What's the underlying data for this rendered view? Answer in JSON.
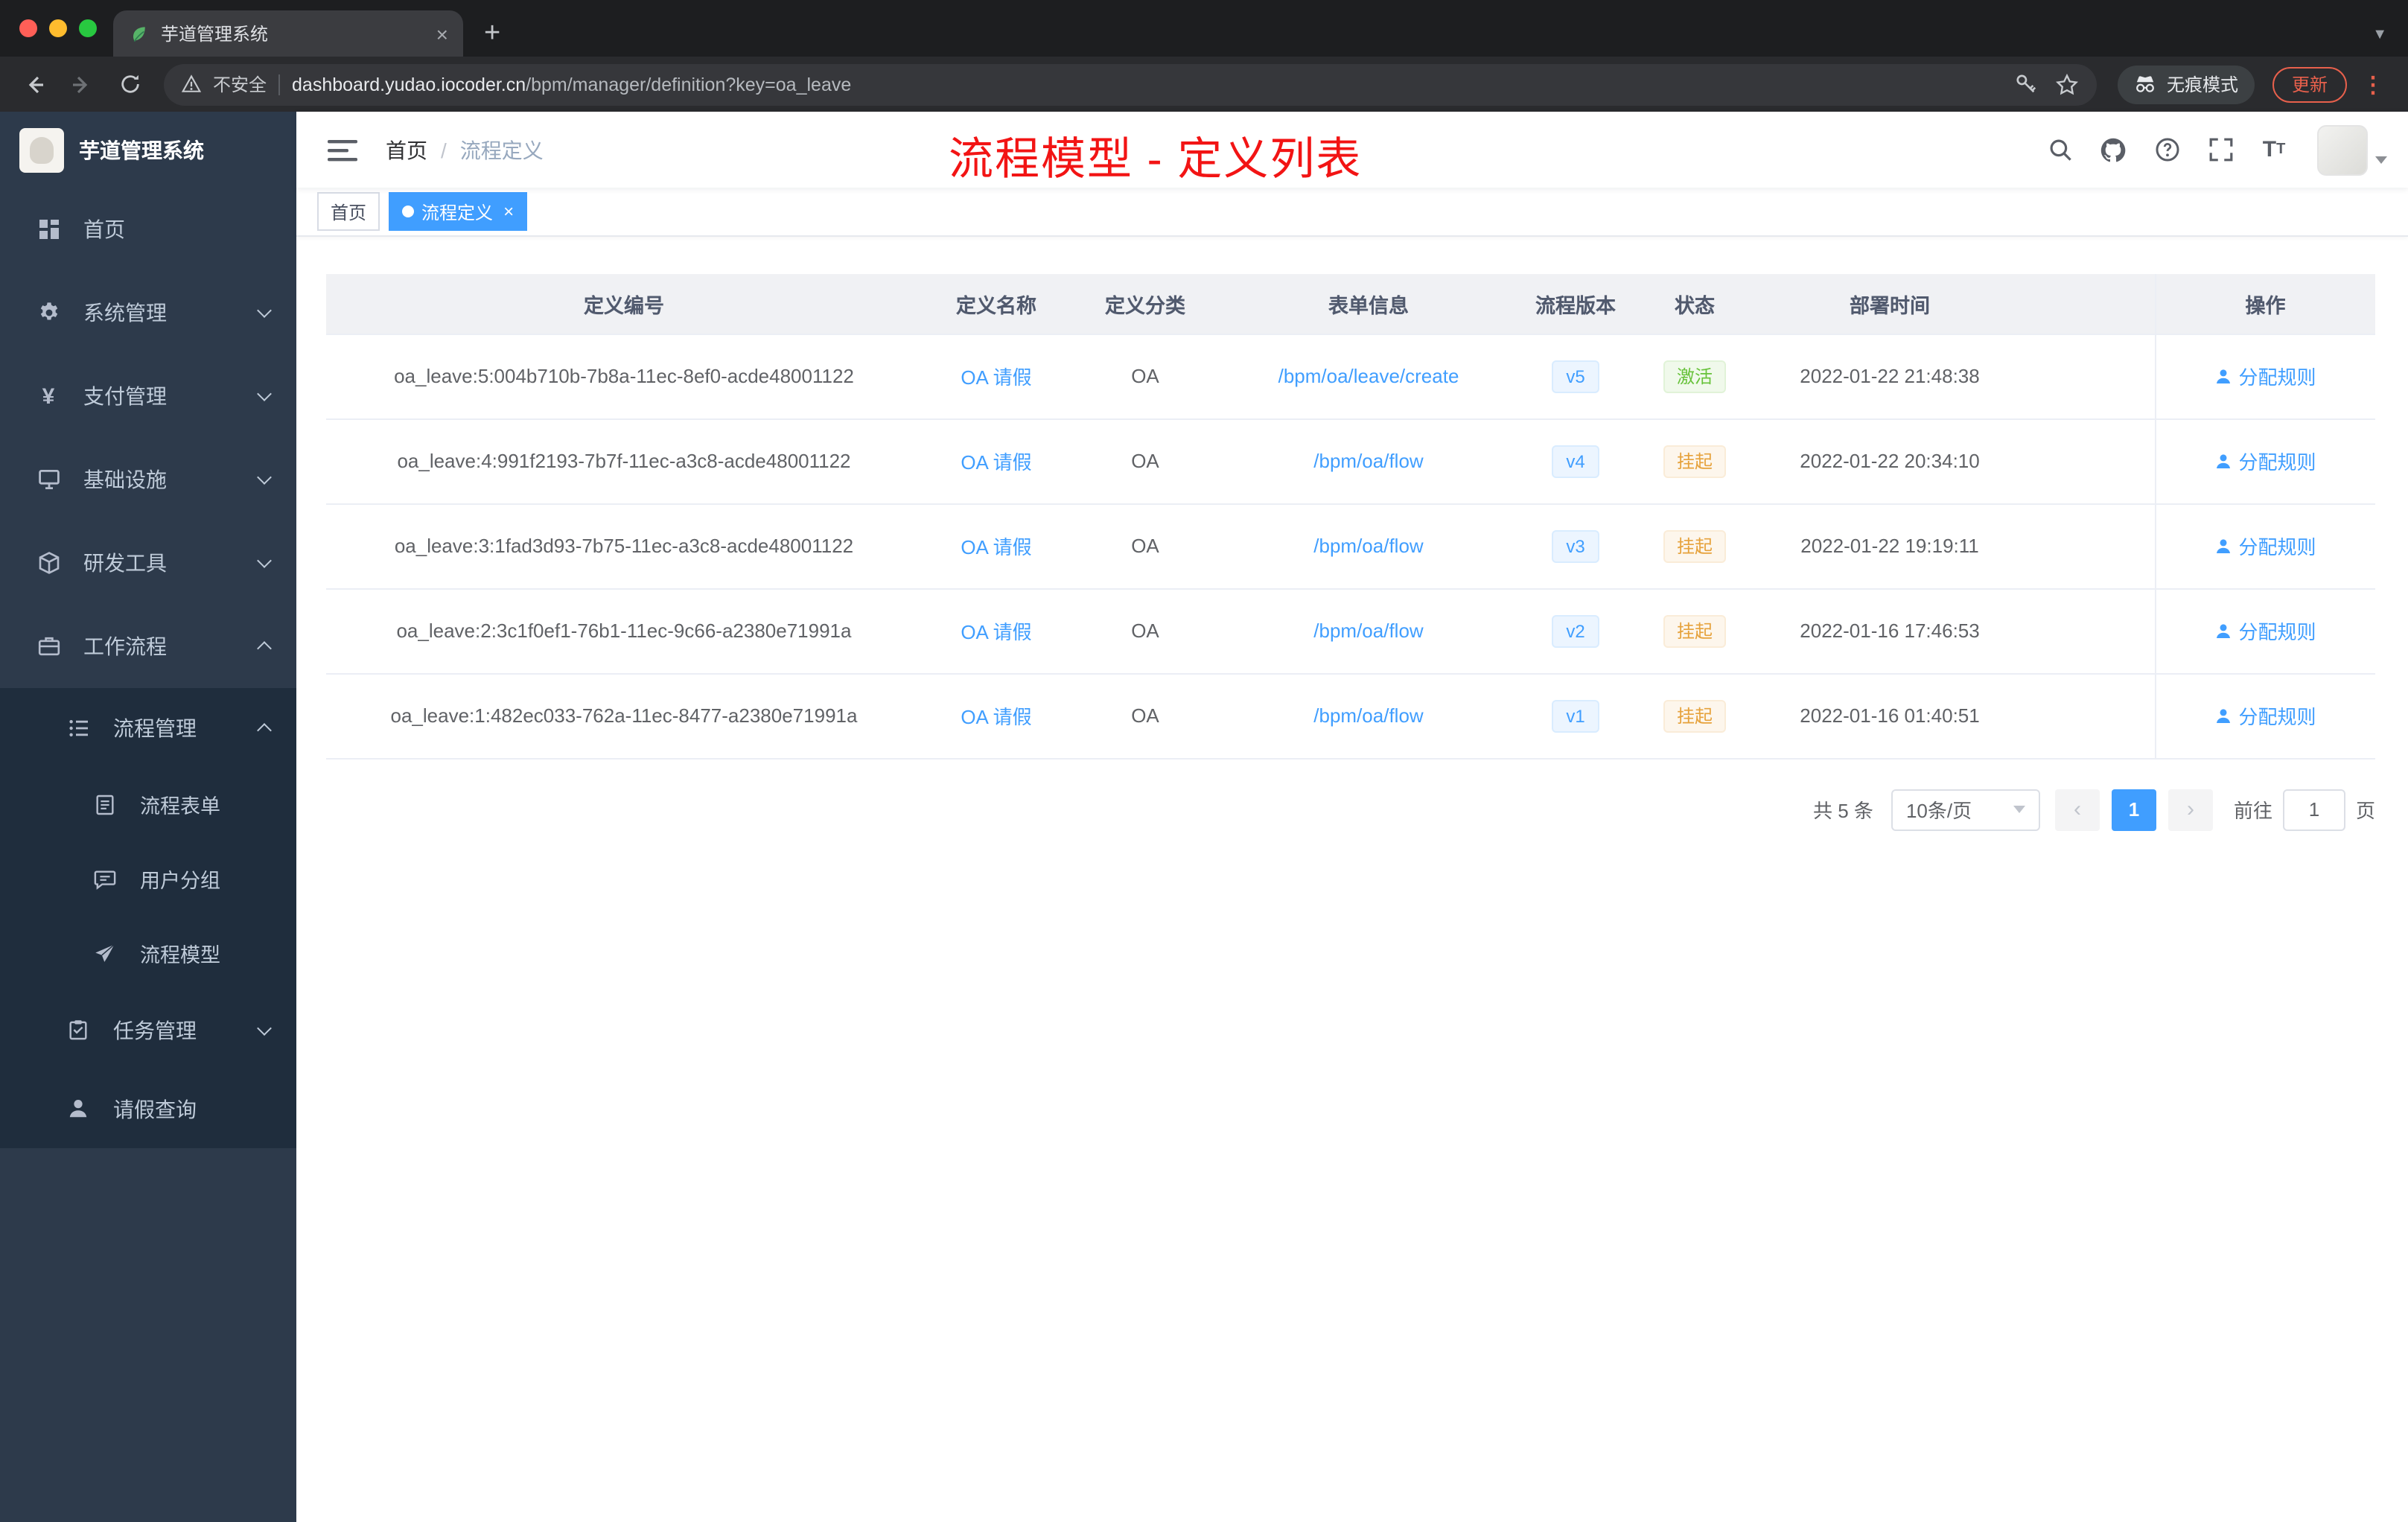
{
  "browser": {
    "tab": {
      "title": "芋道管理系统"
    },
    "address": {
      "security_label": "不安全",
      "host": "dashboard.yudao.iocoder.cn",
      "path": "/bpm/manager/definition?key=oa_leave"
    },
    "incognito_label": "无痕模式",
    "update_label": "更新"
  },
  "sidebar": {
    "logo_title": "芋道管理系统",
    "items": [
      {
        "label": "首页"
      },
      {
        "label": "系统管理"
      },
      {
        "label": "支付管理"
      },
      {
        "label": "基础设施"
      },
      {
        "label": "研发工具"
      },
      {
        "label": "工作流程"
      },
      {
        "label": "流程管理"
      },
      {
        "label": "流程表单"
      },
      {
        "label": "用户分组"
      },
      {
        "label": "流程模型"
      },
      {
        "label": "任务管理"
      },
      {
        "label": "请假查询"
      }
    ]
  },
  "navbar": {
    "breadcrumb": {
      "home": "首页",
      "current": "流程定义"
    },
    "annotation": "流程模型 - 定义列表"
  },
  "tags": {
    "home": "首页",
    "active": "流程定义"
  },
  "table": {
    "headers": {
      "id": "定义编号",
      "name": "定义名称",
      "category": "定义分类",
      "form": "表单信息",
      "version": "流程版本",
      "status": "状态",
      "time": "部署时间",
      "action": "操作"
    },
    "rows": [
      {
        "id": "oa_leave:5:004b710b-7b8a-11ec-8ef0-acde48001122",
        "name": "OA 请假",
        "category": "OA",
        "form": "/bpm/oa/leave/create",
        "version": "v5",
        "status": "激活",
        "status_type": "success",
        "time": "2022-01-22 21:48:38",
        "action": "分配规则"
      },
      {
        "id": "oa_leave:4:991f2193-7b7f-11ec-a3c8-acde48001122",
        "name": "OA 请假",
        "category": "OA",
        "form": "/bpm/oa/flow",
        "version": "v4",
        "status": "挂起",
        "status_type": "warning",
        "time": "2022-01-22 20:34:10",
        "action": "分配规则"
      },
      {
        "id": "oa_leave:3:1fad3d93-7b75-11ec-a3c8-acde48001122",
        "name": "OA 请假",
        "category": "OA",
        "form": "/bpm/oa/flow",
        "version": "v3",
        "status": "挂起",
        "status_type": "warning",
        "time": "2022-01-22 19:19:11",
        "action": "分配规则"
      },
      {
        "id": "oa_leave:2:3c1f0ef1-76b1-11ec-9c66-a2380e71991a",
        "name": "OA 请假",
        "category": "OA",
        "form": "/bpm/oa/flow",
        "version": "v2",
        "status": "挂起",
        "status_type": "warning",
        "time": "2022-01-16 17:46:53",
        "action": "分配规则"
      },
      {
        "id": "oa_leave:1:482ec033-762a-11ec-8477-a2380e71991a",
        "name": "OA 请假",
        "category": "OA",
        "form": "/bpm/oa/flow",
        "version": "v1",
        "status": "挂起",
        "status_type": "warning",
        "time": "2022-01-16 01:40:51",
        "action": "分配规则"
      }
    ]
  },
  "pagination": {
    "total": "共 5 条",
    "page_size": "10条/页",
    "page": "1",
    "goto_label": "前往",
    "goto_value": "1",
    "goto_suffix": "页"
  },
  "colors": {
    "accent": "#409eff",
    "success": "#67c23a",
    "warning": "#e6a23c",
    "sidebar_bg": "#2d3a4b",
    "submenu_bg": "#1f2d3d",
    "annotation_red": "#f21414"
  }
}
